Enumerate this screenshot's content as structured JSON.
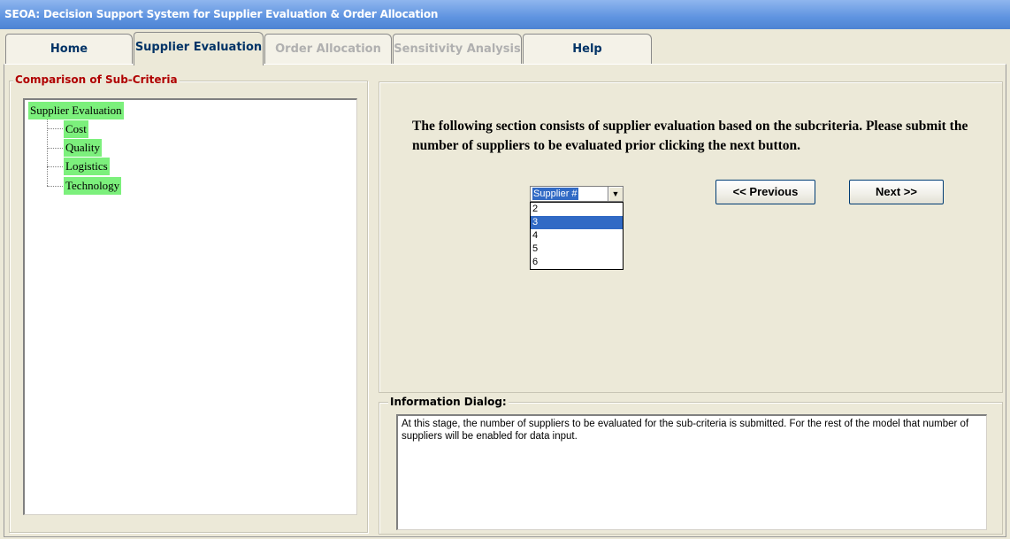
{
  "window": {
    "title": "SEOA: Decision Support System for Supplier Evaluation & Order Allocation"
  },
  "tabs": [
    {
      "label": "Home",
      "state": "normal"
    },
    {
      "label": "Supplier Evaluation",
      "state": "active"
    },
    {
      "label": "Order Allocation",
      "state": "disabled"
    },
    {
      "label": "Sensitivity Analysis",
      "state": "disabled"
    },
    {
      "label": "Help",
      "state": "normal"
    }
  ],
  "left_panel": {
    "group_title": "Comparison of Sub-Criteria",
    "tree": {
      "root": "Supplier Evaluation",
      "children": [
        "Cost",
        "Quality",
        "Logistics",
        "Technology"
      ]
    }
  },
  "main": {
    "instruction": "The following section consists of supplier evaluation based on the subcriteria. Please submit the number of suppliers to be evaluated prior clicking the next button.",
    "supplier_select": {
      "value": "Supplier #",
      "options": [
        "2",
        "3",
        "4",
        "5",
        "6"
      ],
      "highlighted_option": "3"
    },
    "previous_label": "<< Previous",
    "next_label": "Next >>"
  },
  "info_dialog": {
    "title": "Information Dialog:",
    "text": "At this stage, the number of suppliers to be evaluated for the sub-criteria is submitted. For the rest of the model that number of suppliers will be enabled for data input."
  },
  "colors": {
    "title_bar": "#5e93e0",
    "tree_highlight": "#7cf07c",
    "group_title_red": "#b00000",
    "selection_blue": "#316ac5",
    "tab_text": "#003366"
  }
}
